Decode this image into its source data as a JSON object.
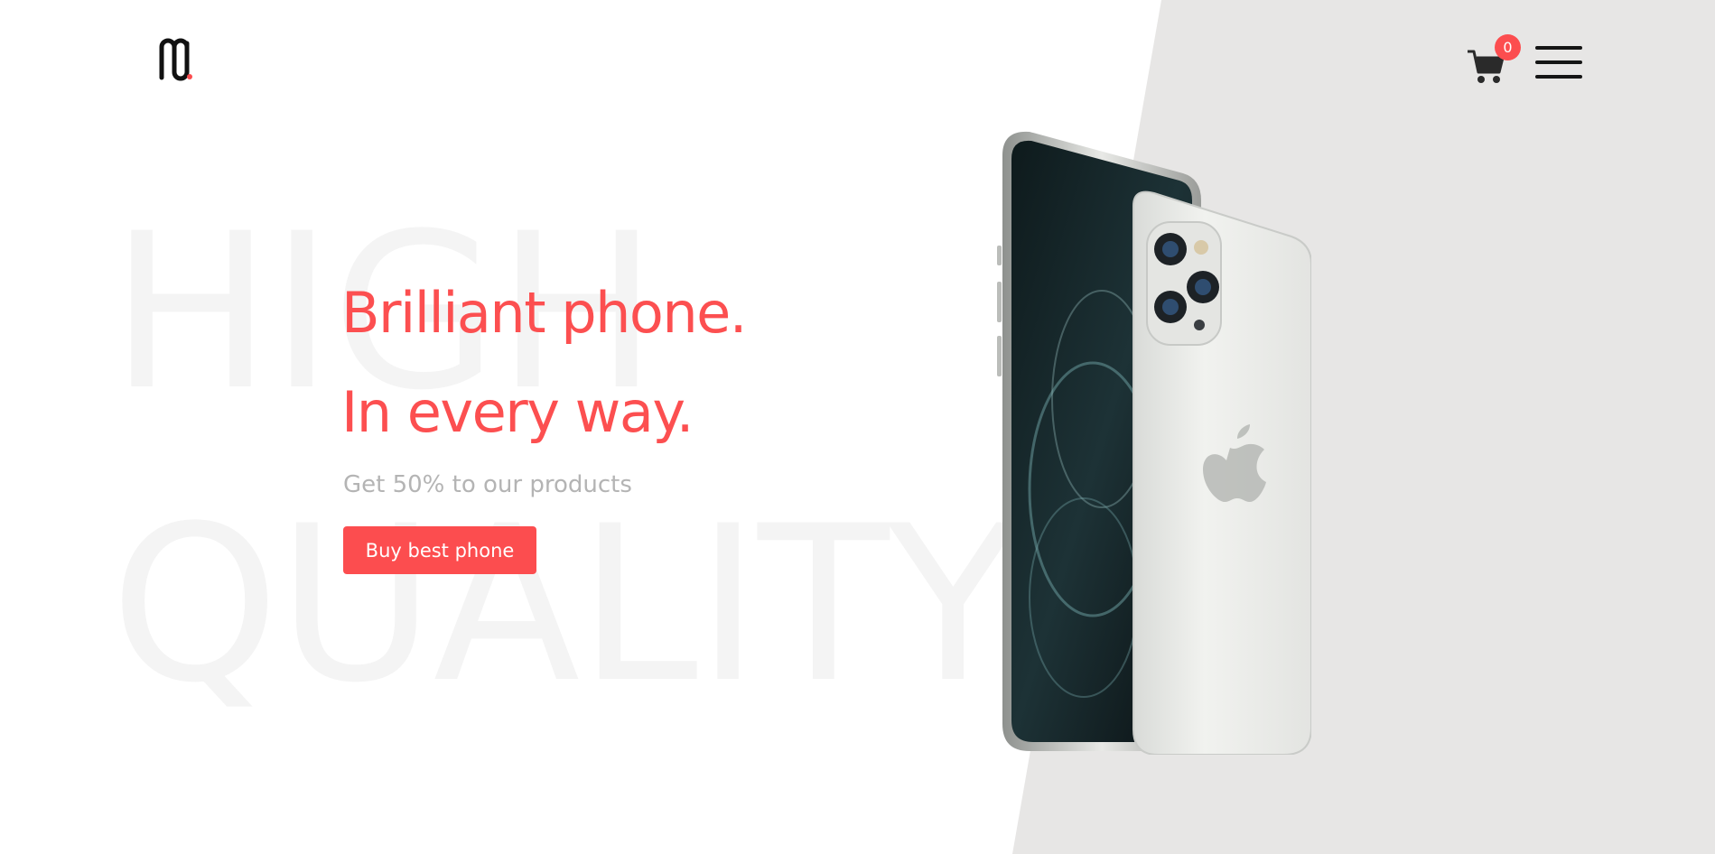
{
  "background": {
    "watermark_line1": "HIGH",
    "watermark_line2": "QUALITY"
  },
  "header": {
    "logo_icon": "m-logo-icon",
    "cart_icon": "shopping-cart-icon",
    "cart_count": "0",
    "menu_icon": "hamburger-menu-icon"
  },
  "hero": {
    "title_line1": "Brilliant phone.",
    "title_line2": "In every way.",
    "subtitle": "Get 50% to our products",
    "cta_label": "Buy best phone",
    "product_image": "smartphone-product-image"
  },
  "colors": {
    "accent": "#fc4d4f",
    "panel": "#e7e6e5",
    "subtitle": "#b4b4b4",
    "watermark": "#f4f4f4"
  }
}
